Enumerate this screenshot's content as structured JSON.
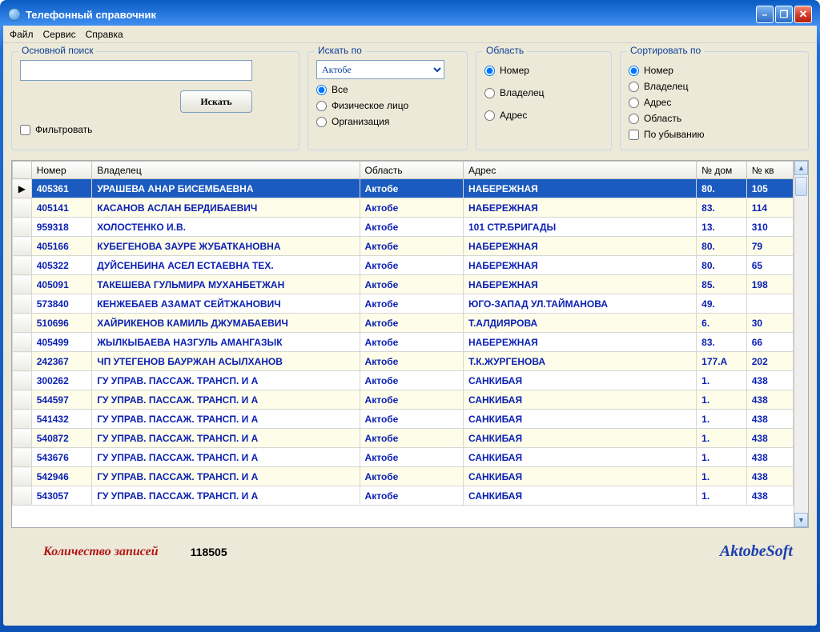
{
  "window": {
    "title": "Телефонный справочник"
  },
  "menu": {
    "file": "Файл",
    "service": "Сервис",
    "help": "Справка"
  },
  "search": {
    "legend": "Основной поиск",
    "value": "",
    "button": "Искать",
    "filter_label": "Фильтровать"
  },
  "searchBy": {
    "legend": "Искать по",
    "region_selected": "Актобе",
    "all": "Все",
    "person": "Физическое лицо",
    "org": "Организация"
  },
  "area": {
    "legend": "Область",
    "number": "Номер",
    "owner": "Владелец",
    "address": "Адрес"
  },
  "sort": {
    "legend": "Сортировать по",
    "number": "Номер",
    "owner": "Владелец",
    "address": "Адрес",
    "area": "Область",
    "desc": "По убыванию"
  },
  "grid": {
    "headers": {
      "number": "Номер",
      "owner": "Владелец",
      "area": "Область",
      "address": "Адрес",
      "house": "№ дом",
      "apt": "№ кв"
    },
    "rows": [
      {
        "num": "405361",
        "owner": "УРАШЕВА АНАР БИСЕМБАЕВНА",
        "area": "Актобе",
        "addr": "НАБЕРЕЖНАЯ",
        "house": "80.",
        "apt": "105"
      },
      {
        "num": "405141",
        "owner": "КАСАНОВ АСЛАН БЕРДИБАЕВИЧ",
        "area": "Актобе",
        "addr": "НАБЕРЕЖНАЯ",
        "house": "83.",
        "apt": "114"
      },
      {
        "num": "959318",
        "owner": "ХОЛОСТЕНКО И.В.",
        "area": "Актобе",
        "addr": "101 СТР.БРИГАДЫ",
        "house": "13.",
        "apt": "310"
      },
      {
        "num": "405166",
        "owner": "КУБЕГЕНОВА ЗАУРЕ ЖУБАТКАНОВНА",
        "area": "Актобе",
        "addr": "НАБЕРЕЖНАЯ",
        "house": "80.",
        "apt": "79"
      },
      {
        "num": "405322",
        "owner": "ДУЙСЕНБИНА АСЕЛ ЕСТАЕВНА ТЕХ.",
        "area": "Актобе",
        "addr": "НАБЕРЕЖНАЯ",
        "house": "80.",
        "apt": "65"
      },
      {
        "num": "405091",
        "owner": "ТАКЕШЕВА ГУЛЬМИРА МУХАНБЕТЖАН",
        "area": "Актобе",
        "addr": "НАБЕРЕЖНАЯ",
        "house": "85.",
        "apt": "198"
      },
      {
        "num": "573840",
        "owner": "КЕНЖЕБАЕВ АЗАМАТ СЕЙТЖАНОВИЧ",
        "area": "Актобе",
        "addr": "ЮГО-ЗАПАД УЛ.ТАЙМАНОВА",
        "house": "49.",
        "apt": ""
      },
      {
        "num": "510696",
        "owner": "ХАЙРИКЕНОВ КАМИЛЬ ДЖУМАБАЕВИЧ",
        "area": "Актобе",
        "addr": "Т.АЛДИЯРОВА",
        "house": "6.",
        "apt": "30"
      },
      {
        "num": "405499",
        "owner": "ЖЫЛКЫБАЕВА НАЗГУЛЬ АМАНГАЗЫК",
        "area": "Актобе",
        "addr": "НАБЕРЕЖНАЯ",
        "house": "83.",
        "apt": "66"
      },
      {
        "num": "242367",
        "owner": "ЧП УТЕГЕНОВ БАУРЖАН АСЫЛХАНОВ",
        "area": "Актобе",
        "addr": "Т.К.ЖУРГЕНОВА",
        "house": "177.А",
        "apt": "202"
      },
      {
        "num": "300262",
        "owner": "ГУ  УПРАВ. ПАССАЖ. ТРАНСП. И А",
        "area": "Актобе",
        "addr": "САНКИБАЯ",
        "house": "1.",
        "apt": "438"
      },
      {
        "num": "544597",
        "owner": "ГУ  УПРАВ. ПАССАЖ. ТРАНСП. И А",
        "area": "Актобе",
        "addr": "САНКИБАЯ",
        "house": "1.",
        "apt": "438"
      },
      {
        "num": "541432",
        "owner": "ГУ  УПРАВ. ПАССАЖ. ТРАНСП. И А",
        "area": "Актобе",
        "addr": "САНКИБАЯ",
        "house": "1.",
        "apt": "438"
      },
      {
        "num": "540872",
        "owner": "ГУ  УПРАВ. ПАССАЖ. ТРАНСП. И А",
        "area": "Актобе",
        "addr": "САНКИБАЯ",
        "house": "1.",
        "apt": "438"
      },
      {
        "num": "543676",
        "owner": "ГУ  УПРАВ. ПАССАЖ. ТРАНСП. И А",
        "area": "Актобе",
        "addr": "САНКИБАЯ",
        "house": "1.",
        "apt": "438"
      },
      {
        "num": "542946",
        "owner": "ГУ  УПРАВ. ПАССАЖ. ТРАНСП. И А",
        "area": "Актобе",
        "addr": "САНКИБАЯ",
        "house": "1.",
        "apt": "438"
      },
      {
        "num": "543057",
        "owner": "ГУ  УПРАВ. ПАССАЖ. ТРАНСП. И А",
        "area": "Актобе",
        "addr": "САНКИБАЯ",
        "house": "1.",
        "apt": "438"
      }
    ]
  },
  "footer": {
    "records_label": "Количество записей",
    "records_count": "118505",
    "brand": "AktobeSoft"
  }
}
